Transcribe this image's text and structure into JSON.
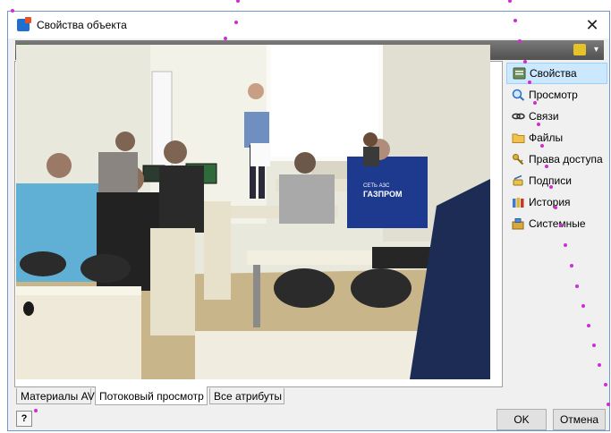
{
  "window": {
    "title": "Свойства объекта",
    "close_glyph": "✕"
  },
  "toolbar": {
    "left_icon": "green-square-icon",
    "right_icon": "yellow-tools-icon",
    "dropdown_glyph": "▾"
  },
  "sidebar": {
    "items": [
      {
        "label": "Свойства",
        "icon": "properties-icon",
        "active": true
      },
      {
        "label": "Просмотр",
        "icon": "magnifier-icon",
        "active": false
      },
      {
        "label": "Связи",
        "icon": "link-icon",
        "active": false
      },
      {
        "label": "Файлы",
        "icon": "folder-icon",
        "active": false
      },
      {
        "label": "Права доступа",
        "icon": "keys-icon",
        "active": false
      },
      {
        "label": "Подписи",
        "icon": "signature-icon",
        "active": false
      },
      {
        "label": "История",
        "icon": "history-icon",
        "active": false
      },
      {
        "label": "Системные",
        "icon": "system-icon",
        "active": false
      }
    ]
  },
  "tabs": [
    {
      "label": "Материалы AV",
      "active": false
    },
    {
      "label": "Потоковый просмотр",
      "active": true
    },
    {
      "label": "Все атрибуты",
      "active": false
    }
  ],
  "video": {
    "jacket_text_top": "СЕТЬ АЗС",
    "jacket_text_brand": "ГАЗПРОМ"
  },
  "footer": {
    "help_label": "?",
    "ok_label": "OK",
    "cancel_label": "Отмена"
  },
  "colors": {
    "accent": "#cce8ff",
    "window_border": "#6f97c9",
    "annotation_dots": "#d02bd5"
  }
}
